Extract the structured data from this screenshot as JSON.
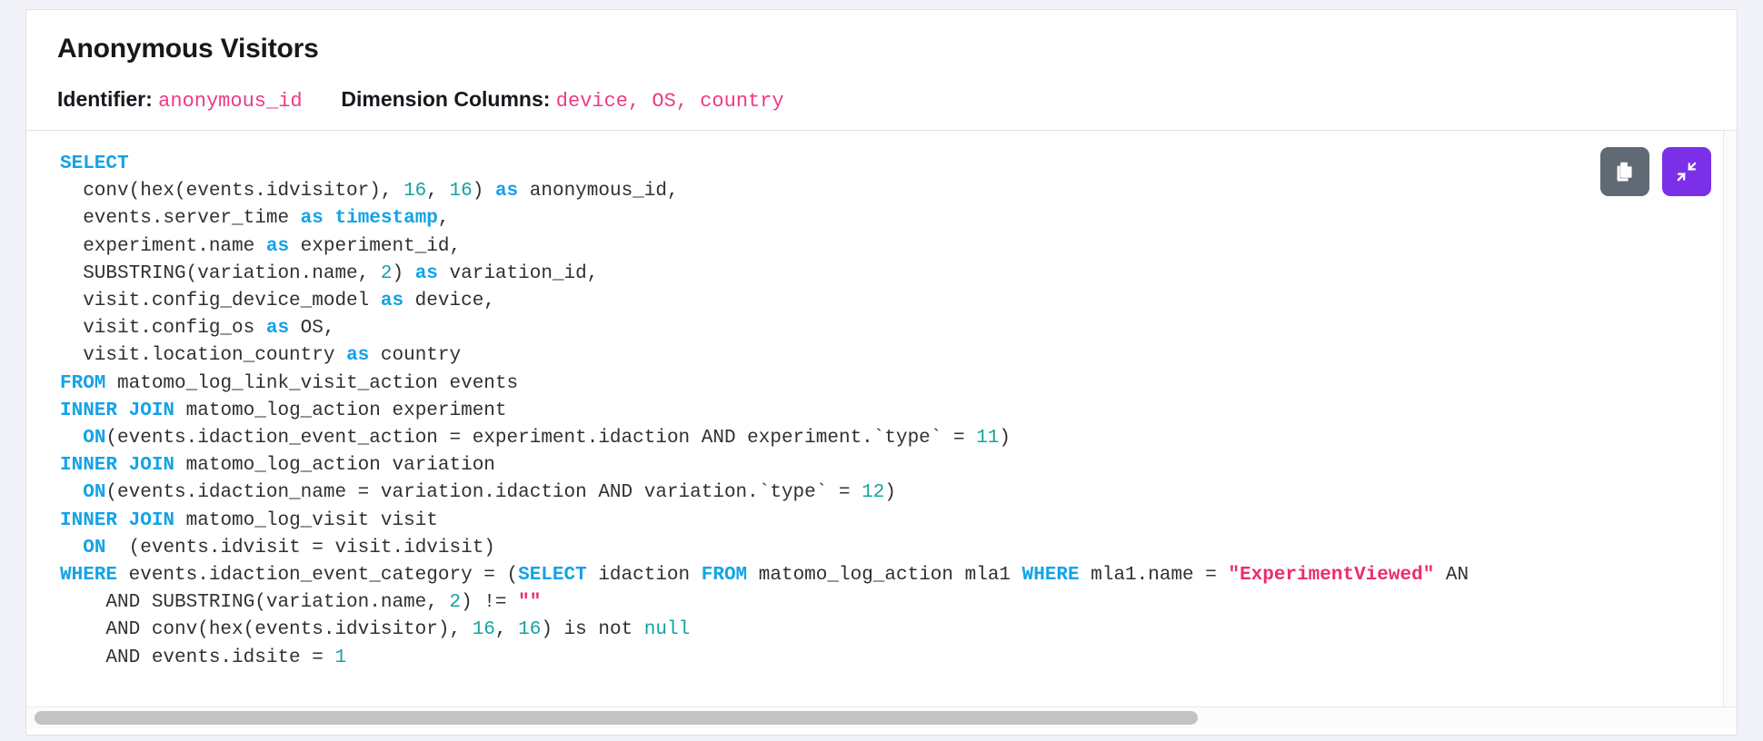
{
  "header": {
    "title": "Anonymous Visitors",
    "identifier_label": "Identifier:",
    "identifier_value": "anonymous_id",
    "dimension_label": "Dimension Columns:",
    "dimension_values": "device, OS, country"
  },
  "actions": {
    "copy_label": "copy-icon",
    "collapse_label": "collapse-icon",
    "copy_color": "#5f6a74",
    "collapse_color": "#7b30e8"
  },
  "colors": {
    "keyword": "#12a3e8",
    "number": "#12a3a0",
    "string": "#ec2b72",
    "plain": "#303030",
    "identifier_pink": "#ec3b83",
    "page_bg": "#f1f3f8",
    "card_bg": "#ffffff"
  },
  "code": {
    "language": "sql",
    "lines": [
      [
        [
          "SELECT",
          "k"
        ]
      ],
      [
        [
          "  conv(hex(events.idvisitor), ",
          "p"
        ],
        [
          "16",
          "n"
        ],
        [
          ", ",
          "p"
        ],
        [
          "16",
          "n"
        ],
        [
          ") ",
          "p"
        ],
        [
          "as",
          "k"
        ],
        [
          " anonymous_id,",
          "p"
        ]
      ],
      [
        [
          "  events.server_time ",
          "p"
        ],
        [
          "as",
          "k"
        ],
        [
          " ",
          "p"
        ],
        [
          "timestamp",
          "k"
        ],
        [
          ",",
          "p"
        ]
      ],
      [
        [
          "  experiment.name ",
          "p"
        ],
        [
          "as",
          "k"
        ],
        [
          " experiment_id,",
          "p"
        ]
      ],
      [
        [
          "  SUBSTRING(variation.name, ",
          "p"
        ],
        [
          "2",
          "n"
        ],
        [
          ") ",
          "p"
        ],
        [
          "as",
          "k"
        ],
        [
          " variation_id,",
          "p"
        ]
      ],
      [
        [
          "  visit.config_device_model ",
          "p"
        ],
        [
          "as",
          "k"
        ],
        [
          " device,",
          "p"
        ]
      ],
      [
        [
          "  visit.config_os ",
          "p"
        ],
        [
          "as",
          "k"
        ],
        [
          " OS,",
          "p"
        ]
      ],
      [
        [
          "  visit.location_country ",
          "p"
        ],
        [
          "as",
          "k"
        ],
        [
          " country",
          "p"
        ]
      ],
      [
        [
          "FROM",
          "k"
        ],
        [
          " matomo_log_link_visit_action events",
          "p"
        ]
      ],
      [
        [
          "INNER",
          "k"
        ],
        [
          " ",
          "p"
        ],
        [
          "JOIN",
          "k"
        ],
        [
          " matomo_log_action experiment",
          "p"
        ]
      ],
      [
        [
          "  ",
          "p"
        ],
        [
          "ON",
          "k"
        ],
        [
          "(events.idaction_event_action = experiment.idaction AND experiment.`type` = ",
          "p"
        ],
        [
          "11",
          "n"
        ],
        [
          ")",
          "p"
        ]
      ],
      [
        [
          "INNER",
          "k"
        ],
        [
          " ",
          "p"
        ],
        [
          "JOIN",
          "k"
        ],
        [
          " matomo_log_action variation",
          "p"
        ]
      ],
      [
        [
          "  ",
          "p"
        ],
        [
          "ON",
          "k"
        ],
        [
          "(events.idaction_name = variation.idaction AND variation.`type` = ",
          "p"
        ],
        [
          "12",
          "n"
        ],
        [
          ")",
          "p"
        ]
      ],
      [
        [
          "INNER",
          "k"
        ],
        [
          " ",
          "p"
        ],
        [
          "JOIN",
          "k"
        ],
        [
          " matomo_log_visit visit",
          "p"
        ]
      ],
      [
        [
          "  ",
          "p"
        ],
        [
          "ON",
          "k"
        ],
        [
          "  (events.idvisit = visit.idvisit)",
          "p"
        ]
      ],
      [
        [
          "WHERE",
          "k"
        ],
        [
          " events.idaction_event_category = (",
          "p"
        ],
        [
          "SELECT",
          "k"
        ],
        [
          " idaction ",
          "p"
        ],
        [
          "FROM",
          "k"
        ],
        [
          " matomo_log_action mla1 ",
          "p"
        ],
        [
          "WHERE",
          "k"
        ],
        [
          " mla1.name = ",
          "p"
        ],
        [
          "\"ExperimentViewed\"",
          "s"
        ],
        [
          " AN",
          "p"
        ]
      ],
      [
        [
          "    AND SUBSTRING(variation.name, ",
          "p"
        ],
        [
          "2",
          "n"
        ],
        [
          ") != ",
          "p"
        ],
        [
          "\"\"",
          "s"
        ]
      ],
      [
        [
          "    AND conv(hex(events.idvisitor), ",
          "p"
        ],
        [
          "16",
          "n"
        ],
        [
          ", ",
          "p"
        ],
        [
          "16",
          "n"
        ],
        [
          ") is not ",
          "p"
        ],
        [
          "null",
          "n"
        ]
      ],
      [
        [
          "    AND events.idsite = ",
          "p"
        ],
        [
          "1",
          "n"
        ]
      ]
    ]
  },
  "scrollbars": {
    "horizontal_thumb_pct": 68,
    "horizontal_position_pct": 0
  }
}
